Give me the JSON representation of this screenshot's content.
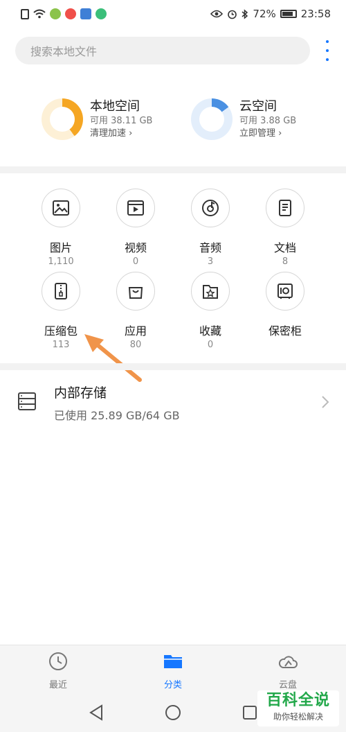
{
  "status_bar": {
    "battery": "72%",
    "time": "23:58"
  },
  "search": {
    "placeholder": "搜索本地文件"
  },
  "storage": {
    "local": {
      "title": "本地空间",
      "available": "可用 38.11 GB",
      "action": "清理加速",
      "used_fraction": 0.4,
      "color": "#f5a623"
    },
    "cloud": {
      "title": "云空间",
      "available": "可用 3.88 GB",
      "action": "立即管理",
      "used_fraction": 0.15,
      "color": "#4a90e2"
    }
  },
  "categories": [
    {
      "label": "图片",
      "count": "1,110",
      "icon": "image-icon"
    },
    {
      "label": "视频",
      "count": "0",
      "icon": "video-icon"
    },
    {
      "label": "音频",
      "count": "3",
      "icon": "audio-icon"
    },
    {
      "label": "文档",
      "count": "8",
      "icon": "document-icon"
    },
    {
      "label": "压缩包",
      "count": "113",
      "icon": "archive-icon"
    },
    {
      "label": "应用",
      "count": "80",
      "icon": "app-icon"
    },
    {
      "label": "收藏",
      "count": "0",
      "icon": "favorite-icon"
    },
    {
      "label": "保密柜",
      "count": "",
      "icon": "safe-icon"
    }
  ],
  "internal_storage": {
    "title": "内部存储",
    "usage": "已使用 25.89 GB/64 GB"
  },
  "bottom_nav": [
    {
      "label": "最近",
      "icon": "clock-icon",
      "active": false
    },
    {
      "label": "分类",
      "icon": "folder-icon",
      "active": true
    },
    {
      "label": "云盘",
      "icon": "cloud-icon",
      "active": false
    }
  ],
  "watermark": {
    "title": "百科全说",
    "subtitle": "助你轻松解决"
  },
  "colors": {
    "accent": "#1677ff",
    "arrow": "#f0944a"
  }
}
